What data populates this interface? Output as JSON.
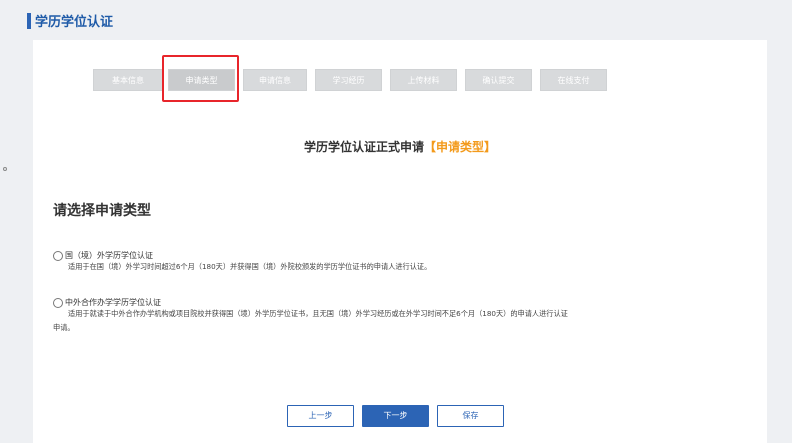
{
  "header": {
    "title": "学历学位认证"
  },
  "steps": [
    {
      "label": "基本信息"
    },
    {
      "label": "申请类型"
    },
    {
      "label": "申请信息"
    },
    {
      "label": "学习经历"
    },
    {
      "label": "上传材料"
    },
    {
      "label": "确认提交"
    },
    {
      "label": "在线支付"
    }
  ],
  "active_step": "申请类型",
  "form": {
    "title": "学历学位认证正式申请",
    "title_highlight": "【申请类型】",
    "section_heading": "请选择申请类型",
    "options": [
      {
        "label": "国（境）外学历学位认证",
        "description": "适用于在国（境）外学习时间超过6个月（180天）并获得国（境）外院校颁发的学历学位证书的申请人进行认证。",
        "selected": false
      },
      {
        "label": "中外合作办学学历学位认证",
        "description_line1": "适用于就读于中外合作办学机构或项目院校并获得国（境）外学历学位证书，且无国（境）外学习经历或在外学习时间不足6个月（180天）的申请人进行认证",
        "description_line2": "申请。",
        "selected": false
      }
    ]
  },
  "buttons": {
    "prev": "上一步",
    "next": "下一步",
    "save": "保存"
  },
  "colors": {
    "accent": "#2c64b5",
    "highlight": "#f39a1b",
    "active_outline": "#e8252b"
  }
}
